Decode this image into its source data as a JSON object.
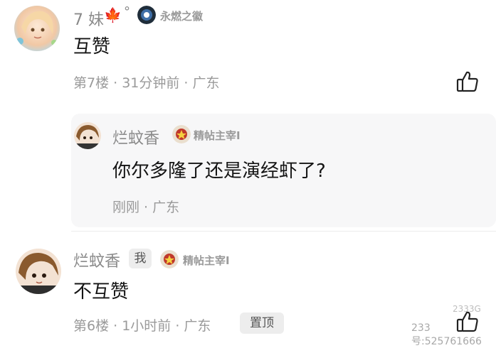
{
  "comment7": {
    "username": "7 妹",
    "emoji": "🍁",
    "degree": "°",
    "badge_label": "永燃之徽",
    "content": "互赞",
    "meta": "第7楼 · 31分钟前 · 广东"
  },
  "reply": {
    "username": "烂蚊香",
    "badge_label": "精帖主宰I",
    "content": "你尔多隆了还是演经虾了?",
    "meta": "刚刚 · 广东"
  },
  "comment6": {
    "username": "烂蚊香",
    "me_tag": "我",
    "badge_label": "精帖主宰I",
    "content": "不互赞",
    "meta": "第6楼 · 1小时前 · 广东",
    "pin_label": "置顶"
  },
  "watermark": {
    "site": "2333G",
    "id_text": "233号:525761666"
  },
  "colors": {
    "text_primary": "#141414",
    "text_secondary": "#9a9a9a",
    "reply_bg": "#f7f7f8"
  },
  "icons": {
    "like": "thumbs-up-icon",
    "leaf": "maple-leaf-icon",
    "badge": "medal-icon"
  }
}
